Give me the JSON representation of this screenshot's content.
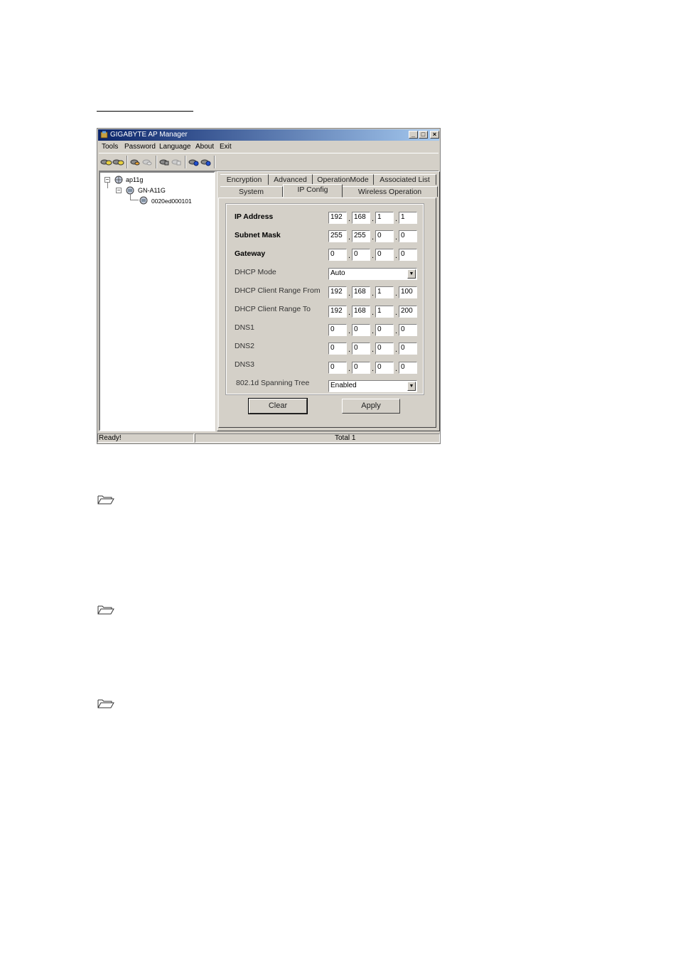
{
  "window": {
    "title": "GIGABYTE AP Manager",
    "controls": {
      "minimize": "_",
      "maximize": "□",
      "close": "×"
    }
  },
  "menu": [
    "Tools",
    "Password",
    "Language",
    "About",
    "Exit"
  ],
  "toolbar_icons": [
    "connect-icon",
    "disconnect-icon",
    "upload-icon",
    "download-icon",
    "refresh-icon",
    "settings-icon",
    "scan-icon",
    "security-icon"
  ],
  "tree": {
    "root": "ap11g",
    "child": "GN-A11G",
    "leaf": "0020ed000101"
  },
  "tabs": {
    "row1": [
      "Encryption",
      "Advanced",
      "OperationMode",
      "Associated List"
    ],
    "row2": [
      "System",
      "IP Config",
      "Wireless Operation"
    ],
    "active": "IP Config"
  },
  "form": {
    "ip_address": {
      "label": "IP Address",
      "values": [
        "192",
        "168",
        "1",
        "1"
      ]
    },
    "subnet_mask": {
      "label": "Subnet Mask",
      "values": [
        "255",
        "255",
        "0",
        "0"
      ]
    },
    "gateway": {
      "label": "Gateway",
      "values": [
        "0",
        "0",
        "0",
        "0"
      ]
    },
    "dhcp_mode": {
      "label": "DHCP Mode",
      "value": "Auto"
    },
    "dhcp_from": {
      "label": "DHCP Client Range From",
      "values": [
        "192",
        "168",
        "1",
        "100"
      ]
    },
    "dhcp_to": {
      "label": "DHCP Client Range To",
      "values": [
        "192",
        "168",
        "1",
        "200"
      ]
    },
    "dns1": {
      "label": "DNS1",
      "values": [
        "0",
        "0",
        "0",
        "0"
      ]
    },
    "dns2": {
      "label": "DNS2",
      "values": [
        "0",
        "0",
        "0",
        "0"
      ]
    },
    "dns3": {
      "label": "DNS3",
      "values": [
        "0",
        "0",
        "0",
        "0"
      ]
    },
    "spanning_tree": {
      "label": "802.1d Spanning Tree",
      "value": "Enabled"
    }
  },
  "buttons": {
    "clear": "Clear",
    "apply": "Apply"
  },
  "status": {
    "left": "Ready!",
    "right": "Total 1"
  }
}
